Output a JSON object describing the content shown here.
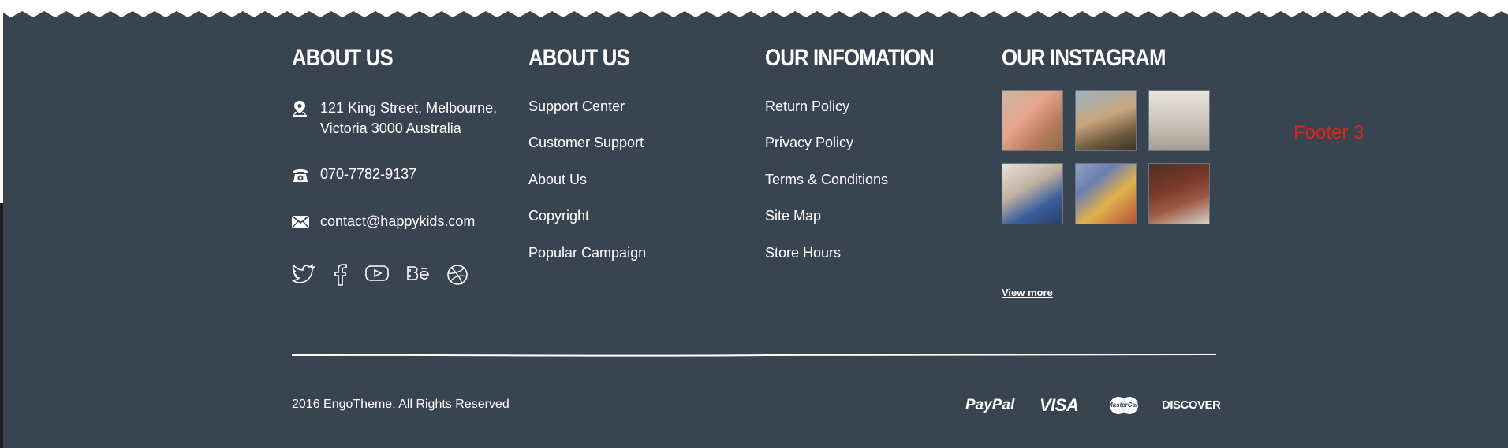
{
  "columns": {
    "contact": {
      "title": "ABOUT US",
      "address_line1": "121 King Street, Melbourne,",
      "address_line2": "Victoria 3000 Australia",
      "phone": "070-7782-9137",
      "email": "contact@happykids.com",
      "social": [
        "twitter-icon",
        "facebook-icon",
        "youtube-icon",
        "behance-icon",
        "dribbble-icon"
      ]
    },
    "about": {
      "title": "ABOUT US",
      "links": [
        "Support Center",
        "Customer Support",
        "About Us",
        "Copyright",
        "Popular Campaign"
      ]
    },
    "information": {
      "title": "OUR INFOMATION",
      "links": [
        "Return Policy",
        "Privacy Policy",
        "Terms & Conditions",
        "Site Map",
        "Store Hours"
      ]
    },
    "instagram": {
      "title": "OUR INSTAGRAM",
      "view_more": "View more"
    }
  },
  "bottom": {
    "copyright": "2016 EngoTheme. All Rights Reserved",
    "payments": {
      "paypal": "PayPal",
      "visa": "VISA",
      "mastercard": "MasterCard",
      "discover": "DISCOVER"
    }
  },
  "annotation": "Footer 3",
  "colors": {
    "background": "#38444f",
    "text": "#ffffff",
    "annotation": "#d7261f"
  }
}
